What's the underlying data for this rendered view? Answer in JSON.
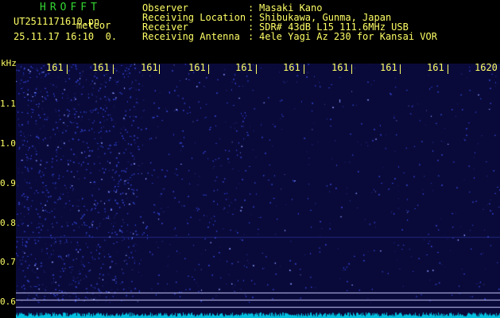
{
  "header": {
    "app_title": "HROFFT",
    "file_name": "UT2511171610.pn",
    "mode": "meteor",
    "datetime": "25.11.17 16:10",
    "extra": "0."
  },
  "station": [
    {
      "label": "Observer",
      "value": "Masaki Kano"
    },
    {
      "label": "Receiving Location",
      "value": "Shibukawa, Gunma, Japan"
    },
    {
      "label": "Receiver",
      "value": "SDR# 43dB L15 111.6MHz USB"
    },
    {
      "label": "Receiving Antenna",
      "value": "4ele Yagi Az 230 for Kansai VOR"
    }
  ],
  "plot": {
    "unit_label": "kHz",
    "frequency_ticks": [
      "161",
      "161",
      "161",
      "161",
      "161",
      "161",
      "161",
      "161",
      "161",
      "1620"
    ],
    "y_ticks": [
      "1.1",
      "1.0",
      "0.9",
      "0.8",
      "0.7",
      "0.6"
    ],
    "colors": {
      "background": "#0a0a3a",
      "noise": "#3040c0",
      "highlight": "#8898ff",
      "trace": "#00c0e0",
      "reference_line": "#c8c8ff"
    }
  }
}
